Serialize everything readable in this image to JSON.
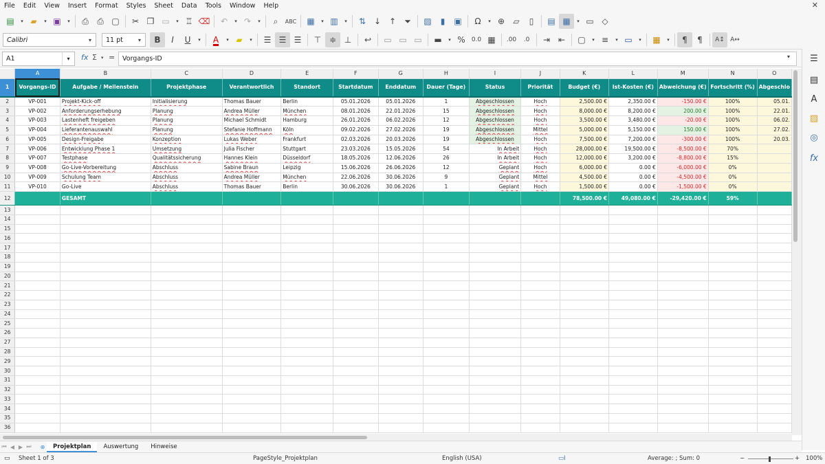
{
  "menu": [
    "File",
    "Edit",
    "View",
    "Insert",
    "Format",
    "Styles",
    "Sheet",
    "Data",
    "Tools",
    "Window",
    "Help"
  ],
  "font": {
    "name": "Calibri",
    "size": "11 pt"
  },
  "cell_ref": "A1",
  "formula": "Vorgangs-ID",
  "columns": [
    "A",
    "B",
    "C",
    "D",
    "E",
    "F",
    "G",
    "H",
    "I",
    "J",
    "K",
    "L",
    "M",
    "N",
    "O"
  ],
  "headers": [
    "Vorgangs-ID",
    "Aufgabe / Meilenstein",
    "Projektphase",
    "Verantwortlich",
    "Standort",
    "Startdatum",
    "Enddatum",
    "Dauer (Tage)",
    "Status",
    "Priorität",
    "Budget (€)",
    "Ist-Kosten (€)",
    "Abweichung (€)",
    "Fortschritt (%)",
    "Abgeschlo"
  ],
  "rows": [
    [
      "VP-001",
      "Projekt-Kick-off",
      "Initialisierung",
      "Thomas Bauer",
      "Berlin",
      "05.01.2026",
      "05.01.2026",
      "1",
      "Abgeschlossen",
      "Hoch",
      "2,500.00 €",
      "2,350.00 €",
      "-150.00 €",
      "100%",
      "05.01."
    ],
    [
      "VP-002",
      "Anforderungserhebung",
      "Planung",
      "Andrea Müller",
      "München",
      "08.01.2026",
      "22.01.2026",
      "15",
      "Abgeschlossen",
      "Hoch",
      "8,000.00 €",
      "8,200.00 €",
      "200.00 €",
      "100%",
      "22.01."
    ],
    [
      "VP-003",
      "Lastenheft freigeben",
      "Planung",
      "Michael Schmidt",
      "Hamburg",
      "26.01.2026",
      "06.02.2026",
      "12",
      "Abgeschlossen",
      "Hoch",
      "3,500.00 €",
      "3,480.00 €",
      "-20.00 €",
      "100%",
      "06.02."
    ],
    [
      "VP-004",
      "Lieferantenauswahl",
      "Planung",
      "Stefanie Hoffmann",
      "Köln",
      "09.02.2026",
      "27.02.2026",
      "19",
      "Abgeschlossen",
      "Mittel",
      "5,000.00 €",
      "5,150.00 €",
      "150.00 €",
      "100%",
      "27.02."
    ],
    [
      "VP-005",
      "Design-Freigabe",
      "Konzeption",
      "Lukas Weber",
      "Frankfurt",
      "02.03.2026",
      "20.03.2026",
      "19",
      "Abgeschlossen",
      "Hoch",
      "7,500.00 €",
      "7,200.00 €",
      "-300.00 €",
      "100%",
      "20.03."
    ],
    [
      "VP-006",
      "Entwicklung Phase 1",
      "Umsetzung",
      "Julia Fischer",
      "Stuttgart",
      "23.03.2026",
      "15.05.2026",
      "54",
      "In Arbeit",
      "Hoch",
      "28,000.00 €",
      "19,500.00 €",
      "-8,500.00 €",
      "70%",
      ""
    ],
    [
      "VP-007",
      "Testphase",
      "Qualitätssicherung",
      "Hannes Klein",
      "Düsseldorf",
      "18.05.2026",
      "12.06.2026",
      "26",
      "In Arbeit",
      "Hoch",
      "12,000.00 €",
      "3,200.00 €",
      "-8,800.00 €",
      "15%",
      ""
    ],
    [
      "VP-008",
      "Go-Live-Vorbereitung",
      "Abschluss",
      "Sabine Braun",
      "Leipzig",
      "15.06.2026",
      "26.06.2026",
      "12",
      "Geplant",
      "Hoch",
      "6,000.00 €",
      "0.00 €",
      "-6,000.00 €",
      "0%",
      ""
    ],
    [
      "VP-009",
      "Schulung Team",
      "Abschluss",
      "Andrea Müller",
      "München",
      "22.06.2026",
      "30.06.2026",
      "9",
      "Geplant",
      "Mittel",
      "4,500.00 €",
      "0.00 €",
      "-4,500.00 €",
      "0%",
      ""
    ],
    [
      "VP-010",
      "Go-Live",
      "Abschluss",
      "Thomas Bauer",
      "Berlin",
      "30.06.2026",
      "30.06.2026",
      "1",
      "Geplant",
      "Hoch",
      "1,500.00 €",
      "0.00 €",
      "-1,500.00 €",
      "0%",
      ""
    ]
  ],
  "total": {
    "label": "GESAMT",
    "budget": "78,500.00 €",
    "ist": "49,080.00 €",
    "abw": "-29,420.00 €",
    "fortschritt": "59%"
  },
  "empty_rows": [
    "13",
    "14",
    "15",
    "16",
    "17",
    "18",
    "19",
    "20",
    "21",
    "22",
    "23",
    "24",
    "25",
    "26",
    "27",
    "28",
    "29",
    "30",
    "31",
    "32",
    "33",
    "34",
    "35",
    "36"
  ],
  "sheets": [
    "Projektplan",
    "Auswertung",
    "Hinweise"
  ],
  "status": {
    "sheet": "Sheet 1 of 3",
    "pagestyle": "PageStyle_Projektplan",
    "language": "English (USA)",
    "sum": "Average: ; Sum: 0",
    "zoom": "100%"
  },
  "colors": {
    "header": "#0f8b88",
    "total": "#1fb09a",
    "selection": "#3d8fd6"
  }
}
